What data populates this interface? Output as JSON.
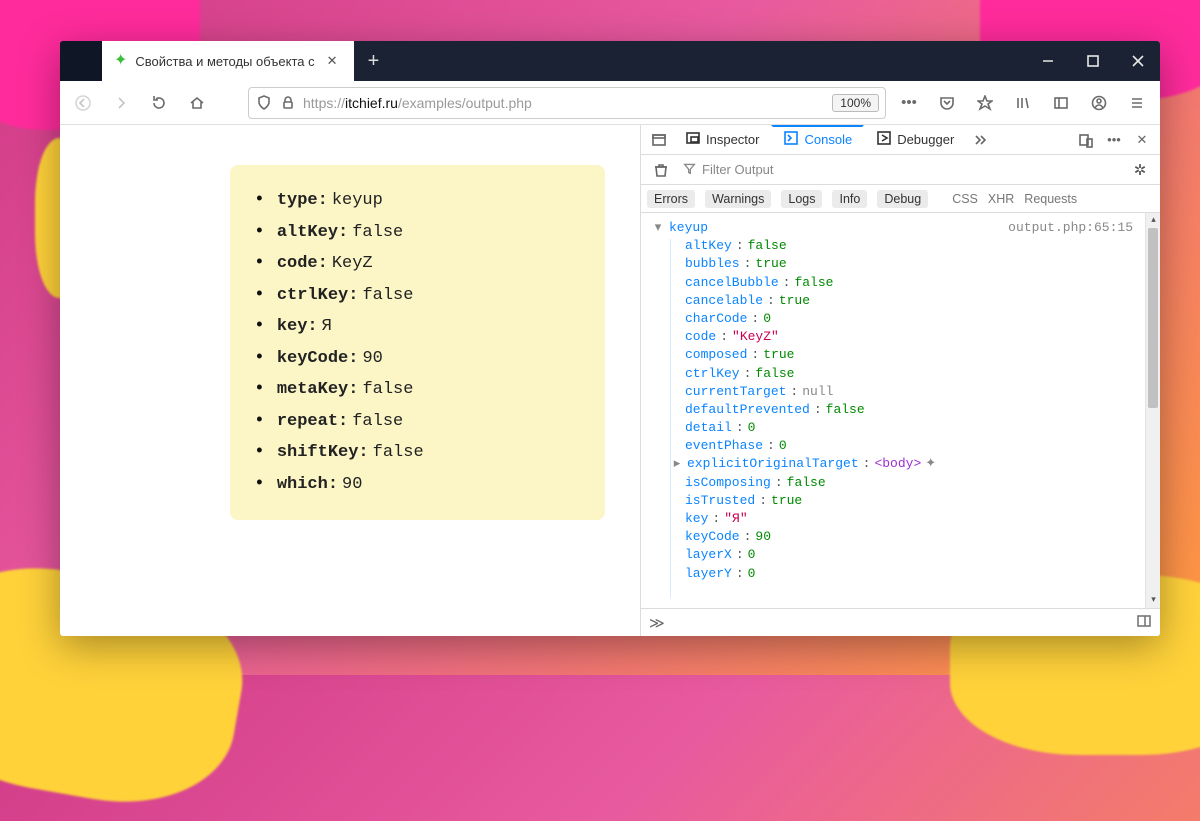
{
  "tab": {
    "title": "Свойства и методы объекта с"
  },
  "url": {
    "proto": "https://",
    "host": "itchief.ru",
    "path": "/examples/output.php"
  },
  "zoom": "100%",
  "card": {
    "items": [
      {
        "k": "type",
        "v": "keyup"
      },
      {
        "k": "altKey",
        "v": "false"
      },
      {
        "k": "code",
        "v": "KeyZ"
      },
      {
        "k": "ctrlKey",
        "v": "false"
      },
      {
        "k": "key",
        "v": "Я"
      },
      {
        "k": "keyCode",
        "v": "90"
      },
      {
        "k": "metaKey",
        "v": "false"
      },
      {
        "k": "repeat",
        "v": "false"
      },
      {
        "k": "shiftKey",
        "v": "false"
      },
      {
        "k": "which",
        "v": "90"
      }
    ]
  },
  "devtools": {
    "tabs": {
      "inspector": "Inspector",
      "console": "Console",
      "debugger": "Debugger"
    },
    "filter_placeholder": "Filter Output",
    "filters": {
      "errors": "Errors",
      "warnings": "Warnings",
      "logs": "Logs",
      "info": "Info",
      "debug": "Debug",
      "css": "CSS",
      "xhr": "XHR",
      "requests": "Requests"
    },
    "log": {
      "event": "keyup",
      "source": "output.php:65:15",
      "props": [
        {
          "k": "altKey",
          "v": "false",
          "t": "n"
        },
        {
          "k": "bubbles",
          "v": "true",
          "t": "n"
        },
        {
          "k": "cancelBubble",
          "v": "false",
          "t": "n"
        },
        {
          "k": "cancelable",
          "v": "true",
          "t": "n"
        },
        {
          "k": "charCode",
          "v": "0",
          "t": "n"
        },
        {
          "k": "code",
          "v": "\"KeyZ\"",
          "t": "s"
        },
        {
          "k": "composed",
          "v": "true",
          "t": "n"
        },
        {
          "k": "ctrlKey",
          "v": "false",
          "t": "n"
        },
        {
          "k": "currentTarget",
          "v": "null",
          "t": "nl"
        },
        {
          "k": "defaultPrevented",
          "v": "false",
          "t": "n"
        },
        {
          "k": "detail",
          "v": "0",
          "t": "n"
        },
        {
          "k": "eventPhase",
          "v": "0",
          "t": "n"
        },
        {
          "k": "explicitOriginalTarget",
          "v": "<body>",
          "t": "tag",
          "expand": true
        },
        {
          "k": "isComposing",
          "v": "false",
          "t": "n"
        },
        {
          "k": "isTrusted",
          "v": "true",
          "t": "n"
        },
        {
          "k": "key",
          "v": "\"Я\"",
          "t": "s"
        },
        {
          "k": "keyCode",
          "v": "90",
          "t": "n"
        },
        {
          "k": "layerX",
          "v": "0",
          "t": "n"
        },
        {
          "k": "layerY",
          "v": "0",
          "t": "n"
        }
      ]
    }
  }
}
